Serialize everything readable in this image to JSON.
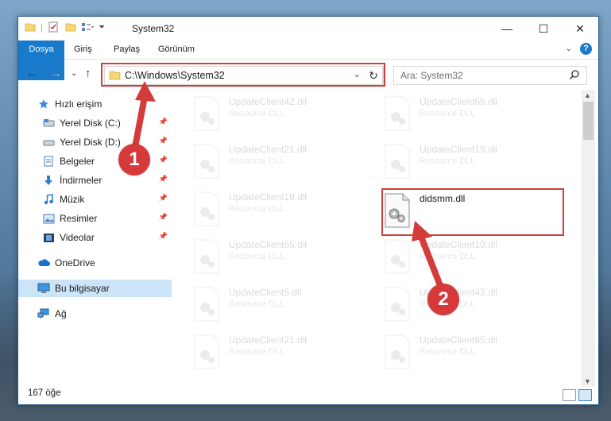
{
  "window": {
    "title": "System32",
    "controls": {
      "minimize": "—",
      "maximize": "☐",
      "close": "✕"
    }
  },
  "ribbon": {
    "tabs": [
      "Dosya",
      "Giriş",
      "Paylaş",
      "Görünüm"
    ],
    "help_label": "?"
  },
  "nav": {
    "address": "C:\\Windows\\System32",
    "search_placeholder": "Ara: System32"
  },
  "sidebar": {
    "items": [
      {
        "label": "Hızlı erişim",
        "icon": "star-icon",
        "pinned": false
      },
      {
        "label": "Yerel Disk (C:)",
        "icon": "drive-icon",
        "pinned": true
      },
      {
        "label": "Yerel Disk (D:)",
        "icon": "drive-icon",
        "pinned": true
      },
      {
        "label": "Belgeler",
        "icon": "documents-icon",
        "pinned": true
      },
      {
        "label": "İndirmeler",
        "icon": "download-icon",
        "pinned": true
      },
      {
        "label": "Müzik",
        "icon": "music-icon",
        "pinned": true
      },
      {
        "label": "Resimler",
        "icon": "pictures-icon",
        "pinned": true
      },
      {
        "label": "Videolar",
        "icon": "videos-icon",
        "pinned": true
      },
      {
        "label": "OneDrive",
        "icon": "cloud-icon",
        "pinned": false
      },
      {
        "label": "Bu bilgisayar",
        "icon": "computer-icon",
        "pinned": false,
        "selected": true
      },
      {
        "label": "Ağ",
        "icon": "network-icon",
        "pinned": false
      }
    ]
  },
  "files": {
    "left": [
      {
        "name": "UpdateClient42.dll",
        "type": "Resource DLL"
      },
      {
        "name": "UpdateClient21.dll",
        "type": "Resource DLL"
      },
      {
        "name": "UpdateClient19.dll",
        "type": "Resource DLL"
      },
      {
        "name": "UpdateClient65.dll",
        "type": "Resource DLL"
      },
      {
        "name": "UpdateClient5.dll",
        "type": "Resource DLL"
      },
      {
        "name": "UpdateClient21.dll",
        "type": "Resource DLL"
      }
    ],
    "right": [
      {
        "name": "UpdateClient65.dll",
        "type": "Resource DLL"
      },
      {
        "name": "UpdateClient19.dll",
        "type": "Resource DLL"
      },
      {
        "name": "didsmm.dll",
        "type": ""
      },
      {
        "name": "UpdateClient19.dll",
        "type": "Resource DLL"
      },
      {
        "name": "UpdateClient42.dll",
        "type": "Resource DLL"
      },
      {
        "name": "UpdateClient65.dll",
        "type": "Resource DLL"
      }
    ]
  },
  "status": {
    "item_count": "167 öğe"
  },
  "annotations": {
    "marker1": "1",
    "marker2": "2",
    "color": "#d43c3c"
  }
}
